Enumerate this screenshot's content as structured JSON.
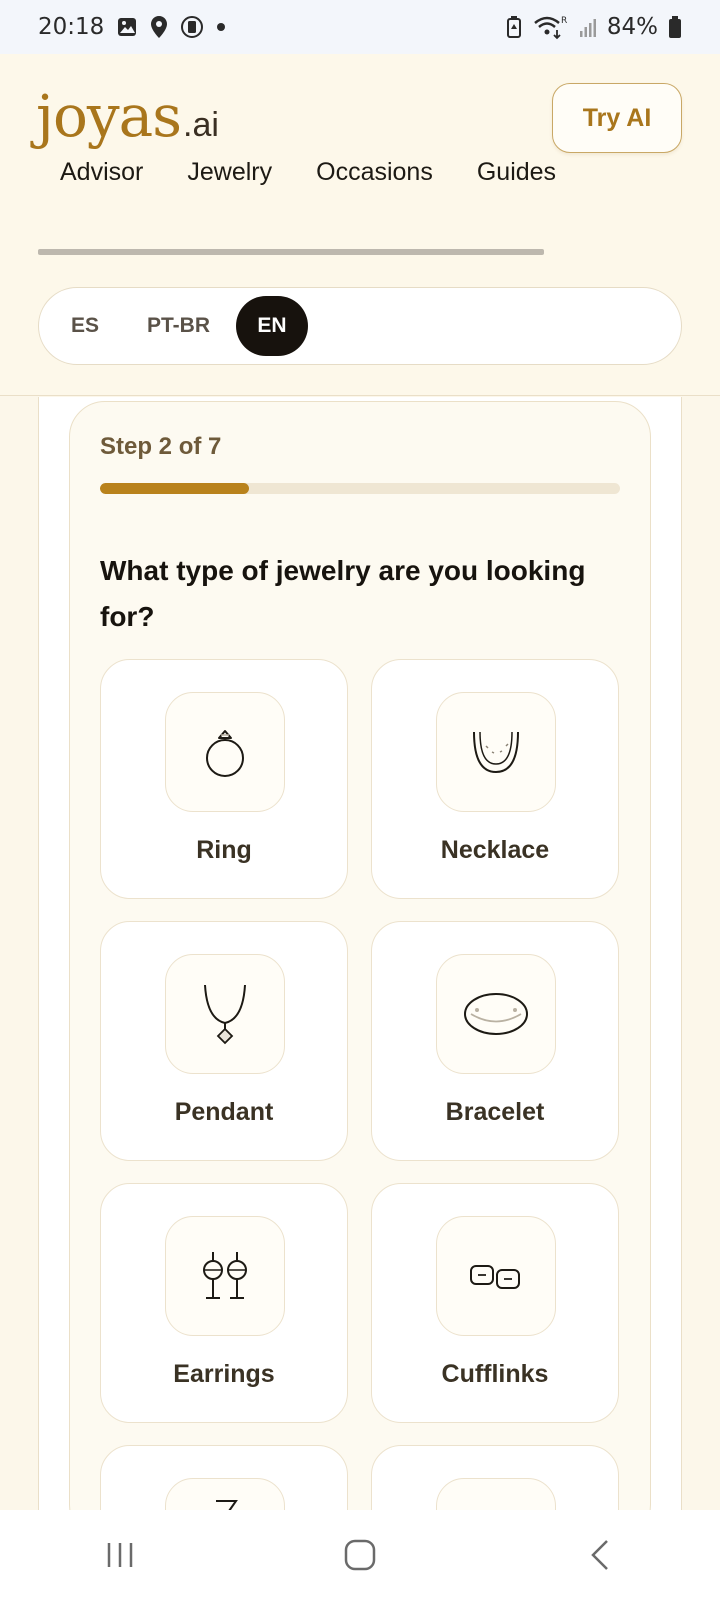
{
  "status_bar": {
    "time": "20:18",
    "battery": "84%"
  },
  "header": {
    "logo_main": "joyas",
    "logo_ext": ".ai",
    "try_ai_label": "Try AI"
  },
  "nav": {
    "items": [
      {
        "label": "Advisor"
      },
      {
        "label": "Jewelry"
      },
      {
        "label": "Occasions"
      },
      {
        "label": "Guides"
      }
    ]
  },
  "language": {
    "options": [
      {
        "label": "ES",
        "active": false
      },
      {
        "label": "PT-BR",
        "active": false
      },
      {
        "label": "EN",
        "active": true
      }
    ]
  },
  "wizard": {
    "step_label": "Step 2 of 7",
    "progress_fraction": 0.2857,
    "question": "What type of jewelry are you looking for?",
    "options": [
      {
        "label": "Ring",
        "icon": "ring-icon"
      },
      {
        "label": "Necklace",
        "icon": "necklace-icon"
      },
      {
        "label": "Pendant",
        "icon": "pendant-icon"
      },
      {
        "label": "Bracelet",
        "icon": "bracelet-icon"
      },
      {
        "label": "Earrings",
        "icon": "earrings-icon"
      },
      {
        "label": "Cufflinks",
        "icon": "cufflinks-icon"
      }
    ]
  },
  "colors": {
    "accent": "#b9821c",
    "logo": "#a9761c",
    "active_lang_bg": "#17120d"
  }
}
